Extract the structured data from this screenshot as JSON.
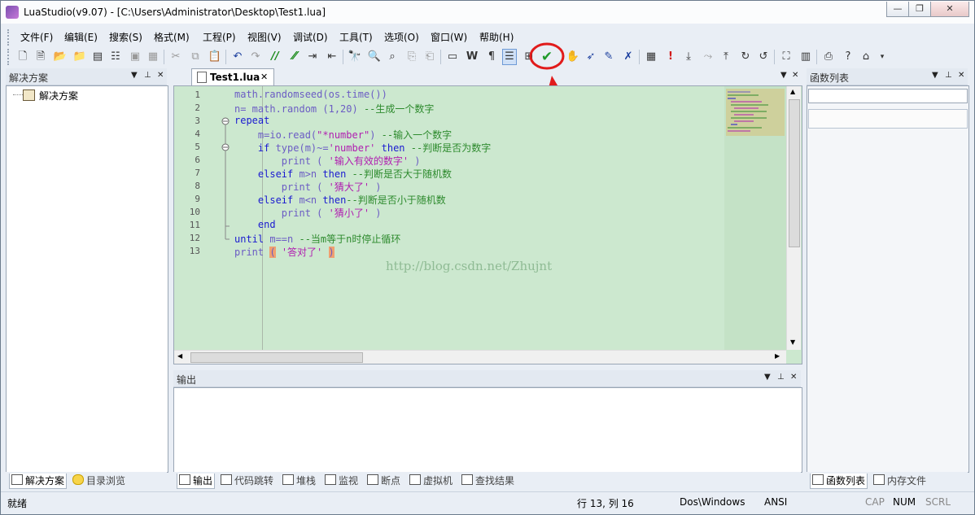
{
  "window": {
    "title": "LuaStudio(v9.07) - [C:\\Users\\Administrator\\Desktop\\Test1.lua]",
    "minimize_glyph": "—",
    "restore_glyph": "❐",
    "close_glyph": "✕"
  },
  "menu": [
    "文件(F)",
    "编辑(E)",
    "搜索(S)",
    "格式(M)",
    "工程(P)",
    "视图(V)",
    "调试(D)",
    "工具(T)",
    "选项(O)",
    "窗口(W)",
    "帮助(H)"
  ],
  "toolbar": {
    "highlight_check": "✔",
    "accent": "#e11b1b",
    "check_color": "#1f9a2a"
  },
  "left_panel": {
    "title": "解决方案",
    "tree_root": "解决方案",
    "tabs": [
      "解决方案",
      "目录浏览"
    ]
  },
  "editor": {
    "tab_label": "Test1.lua",
    "line_numbers": [
      "1",
      "2",
      "3",
      "4",
      "5",
      "6",
      "7",
      "8",
      "9",
      "10",
      "11",
      "12",
      "13"
    ],
    "lines": [
      [
        {
          "t": "math.randomseed(os.time())",
          "c": "#6b5cc4"
        }
      ],
      [
        {
          "t": "n= math.random (1,20) ",
          "c": "#6b5cc4"
        },
        {
          "t": "--生成一个数字",
          "c": "#2d8a2d"
        }
      ],
      [
        {
          "t": "repeat",
          "c": "#1a1ad0"
        }
      ],
      [
        {
          "t": "    m=io.read(",
          "c": "#6b5cc4"
        },
        {
          "t": "\"*number\"",
          "c": "#b01eb0"
        },
        {
          "t": ") ",
          "c": "#6b5cc4"
        },
        {
          "t": "--输入一个数字",
          "c": "#2d8a2d"
        }
      ],
      [
        {
          "t": "    if ",
          "c": "#1a1ad0"
        },
        {
          "t": "type(m)~=",
          "c": "#6b5cc4"
        },
        {
          "t": "'number'",
          "c": "#b01eb0"
        },
        {
          "t": " then ",
          "c": "#1a1ad0"
        },
        {
          "t": "--判断是否为数字",
          "c": "#2d8a2d"
        }
      ],
      [
        {
          "t": "        print ( ",
          "c": "#6b5cc4"
        },
        {
          "t": "'输入有效的数字'",
          "c": "#b01eb0"
        },
        {
          "t": " )",
          "c": "#6b5cc4"
        }
      ],
      [
        {
          "t": "    elseif ",
          "c": "#1a1ad0"
        },
        {
          "t": "m>n ",
          "c": "#6b5cc4"
        },
        {
          "t": "then ",
          "c": "#1a1ad0"
        },
        {
          "t": "--判断是否大于随机数",
          "c": "#2d8a2d"
        }
      ],
      [
        {
          "t": "        print ( ",
          "c": "#6b5cc4"
        },
        {
          "t": "'猜大了'",
          "c": "#b01eb0"
        },
        {
          "t": " )",
          "c": "#6b5cc4"
        }
      ],
      [
        {
          "t": "    elseif ",
          "c": "#1a1ad0"
        },
        {
          "t": "m<n ",
          "c": "#6b5cc4"
        },
        {
          "t": "then",
          "c": "#1a1ad0"
        },
        {
          "t": "--判断是否小于随机数",
          "c": "#2d8a2d"
        }
      ],
      [
        {
          "t": "        print ( ",
          "c": "#6b5cc4"
        },
        {
          "t": "'猜小了'",
          "c": "#b01eb0"
        },
        {
          "t": " )",
          "c": "#6b5cc4"
        }
      ],
      [
        {
          "t": "    end",
          "c": "#1a1ad0"
        }
      ],
      [
        {
          "t": "until ",
          "c": "#1a1ad0"
        },
        {
          "t": "m==n ",
          "c": "#6b5cc4"
        },
        {
          "t": "--当m等于n时停止循环",
          "c": "#2d8a2d"
        }
      ],
      [
        {
          "t": "print ",
          "c": "#6b5cc4"
        },
        {
          "t": "(",
          "c": "#6b5cc4",
          "bg": "#f0a070"
        },
        {
          "t": " ",
          "c": "#6b5cc4"
        },
        {
          "t": "'答对了'",
          "c": "#b01eb0"
        },
        {
          "t": " ",
          "c": "#6b5cc4"
        },
        {
          "t": ")",
          "c": "#6b5cc4",
          "bg": "#f0a070"
        }
      ]
    ],
    "watermark": "http://blog.csdn.net/Zhujnt",
    "background": "#cce8cf"
  },
  "output_panel": {
    "title": "输出",
    "tabs": [
      "输出",
      "代码跳转",
      "堆栈",
      "监视",
      "断点",
      "虚拟机",
      "查找结果"
    ]
  },
  "right_panel": {
    "title": "函数列表",
    "tabs": [
      "函数列表",
      "内存文件"
    ]
  },
  "statusbar": {
    "ready": "就绪",
    "position": "行 13, 列 16",
    "line_ending": "Dos\\Windows",
    "encoding": "ANSI",
    "cap": "CAP",
    "num": "NUM",
    "scrl": "SCRL"
  }
}
